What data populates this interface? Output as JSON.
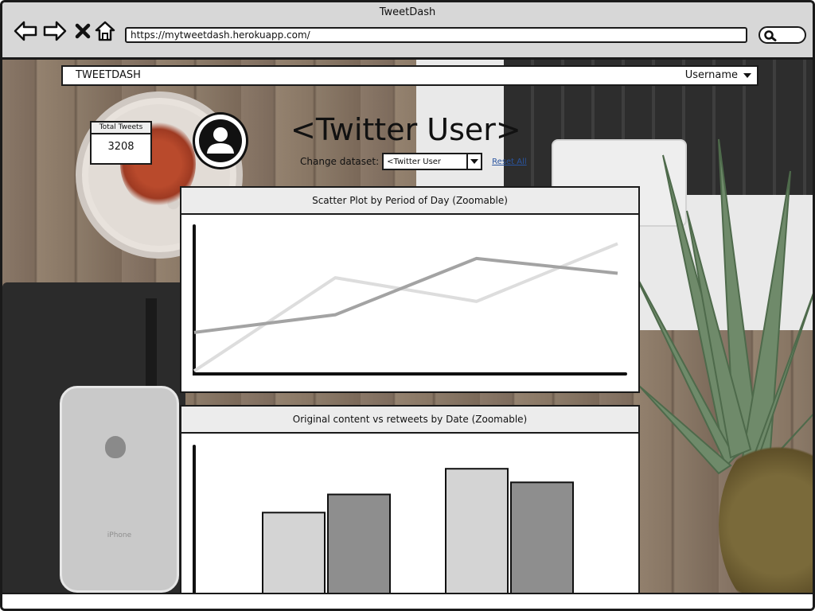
{
  "window": {
    "title": "TweetDash",
    "url": "https://mytweetdash.herokuapp.com/"
  },
  "icons": {
    "back": "back-arrow-icon",
    "forward": "forward-arrow-icon",
    "close": "close-icon",
    "home": "home-icon",
    "search": "search-icon",
    "avatar": "user-avatar-icon",
    "dropdown": "caret-down-icon"
  },
  "navbar": {
    "brand": "TWEETDASH",
    "user": "Username"
  },
  "stats": {
    "total_label": "Total Tweets",
    "total_value": "3208"
  },
  "profile": {
    "title": "<Twitter User>",
    "dataset_label": "Change dataset:",
    "dataset_selected": "<Twitter User",
    "reset_label": "Reset All"
  },
  "charts": {
    "scatter_title": "Scatter Plot by Period of Day (Zoomable)",
    "bar_title": "Original content vs retweets by Date (Zoomable)"
  },
  "colors": {
    "series_light": "#dddddd",
    "series_dark": "#a3a3a3",
    "bar_light": "#d4d4d4",
    "bar_dark": "#8e8e8e"
  },
  "chart_data": [
    {
      "type": "line",
      "title": "Scatter Plot by Period of Day (Zoomable)",
      "x": [
        0,
        1,
        2,
        3
      ],
      "ylim": [
        0,
        100
      ],
      "series": [
        {
          "values": [
            2,
            65,
            49,
            88
          ]
        },
        {
          "values": [
            28,
            40,
            78,
            68
          ]
        }
      ]
    },
    {
      "type": "bar",
      "title": "Original content vs retweets by Date (Zoomable)",
      "categories": [
        "",
        ""
      ],
      "ylim": [
        0,
        100
      ],
      "series": [
        {
          "values": [
            53,
            82
          ]
        },
        {
          "values": [
            65,
            73
          ]
        }
      ]
    }
  ]
}
